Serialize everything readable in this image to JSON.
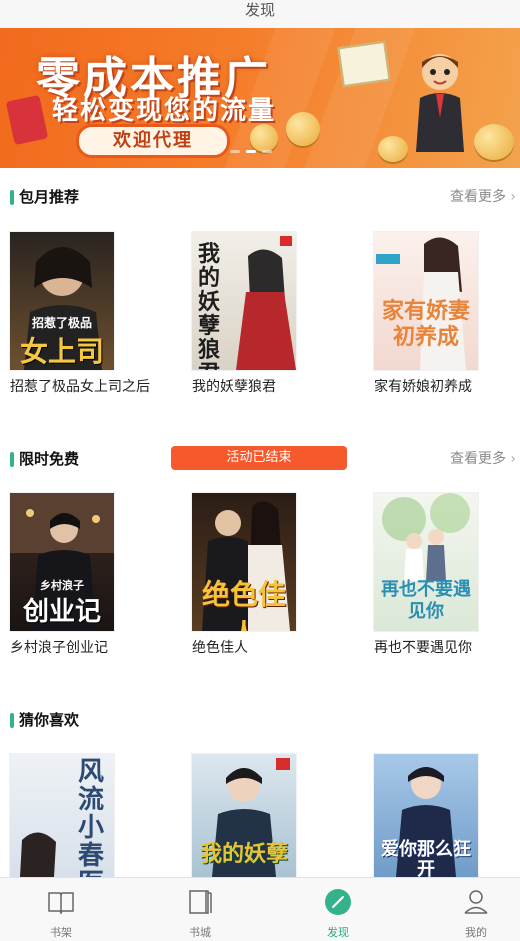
{
  "page": {
    "title": "发现"
  },
  "banner": {
    "headline": "零成本推广",
    "subline": "轻松变现您的流量",
    "cta": "欢迎代理",
    "slide_count": 3,
    "active_slide": 1
  },
  "sections": {
    "monthly": {
      "title": "包月推荐",
      "more": "查看更多",
      "books": [
        {
          "title": "招惹了极品女上司之后",
          "cover_text": "女上司",
          "cover_sub": "招惹了极品",
          "cover_colors": [
            "#2a2420",
            "#6d5030"
          ]
        },
        {
          "title": "我的妖孽狼君",
          "cover_text": "我的妖孽狼君",
          "cover_sub": "",
          "cover_colors": [
            "#f2efe8",
            "#d9d2c6"
          ]
        },
        {
          "title": "家有娇娘初养成",
          "cover_text": "家有娇妻初养成",
          "cover_sub": "",
          "cover_colors": [
            "#fbf1ec",
            "#f2d8d0"
          ]
        }
      ]
    },
    "free": {
      "title": "限时免费",
      "status": "活动已结束",
      "more": "查看更多",
      "books": [
        {
          "title": "乡村浪子创业记",
          "cover_text": "创业记",
          "cover_sub": "乡村浪子",
          "cover_colors": [
            "#3a2a24",
            "#1a1412"
          ]
        },
        {
          "title": "绝色佳人",
          "cover_text": "绝色佳人",
          "cover_sub": "",
          "cover_colors": [
            "#2b1d16",
            "#5a3d22"
          ]
        },
        {
          "title": "再也不要遇见你",
          "cover_text": "再也不要遇见你",
          "cover_sub": "",
          "cover_colors": [
            "#f3f6ef",
            "#dbe8d6"
          ]
        }
      ]
    },
    "guess": {
      "title": "猜你喜欢",
      "books": [
        {
          "title": "",
          "cover_text": "风流小春医",
          "cover_sub": "",
          "cover_colors": [
            "#eef2f6",
            "#d7e0ea"
          ]
        },
        {
          "title": "",
          "cover_text": "我的妖孽",
          "cover_sub": "",
          "cover_colors": [
            "#dce7ee",
            "#a9c2d2"
          ]
        },
        {
          "title": "",
          "cover_text": "爱你那么狂开",
          "cover_sub": "",
          "cover_colors": [
            "#a8c8e8",
            "#6f9cc8"
          ]
        }
      ]
    }
  },
  "tabs": [
    {
      "label": "书架",
      "icon": "book-open-icon",
      "active": false
    },
    {
      "label": "书城",
      "icon": "book-closed-icon",
      "active": false
    },
    {
      "label": "发现",
      "icon": "compass-icon",
      "active": true
    },
    {
      "label": "我的",
      "icon": "user-icon",
      "active": false
    }
  ],
  "colors": {
    "accent": "#33b28c",
    "status_pill": "#f65a2c",
    "banner": "#f26a1d"
  }
}
